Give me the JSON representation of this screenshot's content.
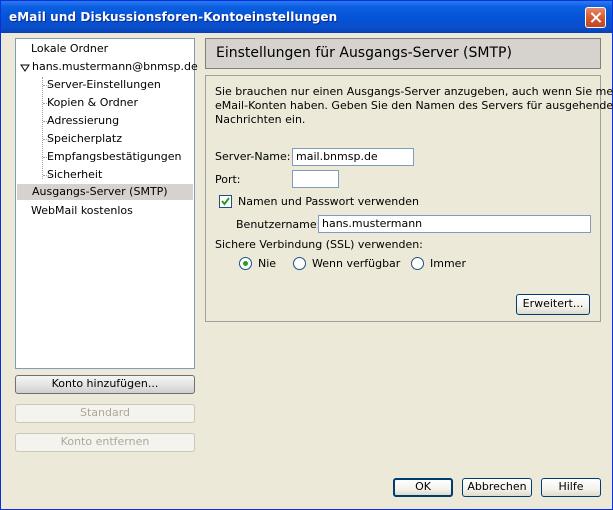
{
  "window": {
    "title": "eMail und Diskussionsforen-Kontoeinstellungen"
  },
  "tree": {
    "items": [
      {
        "label": "Lokale Ordner"
      },
      {
        "label": "hans.mustermann@bnmsp.de"
      },
      {
        "label": "Server-Einstellungen"
      },
      {
        "label": "Kopien & Ordner"
      },
      {
        "label": "Adressierung"
      },
      {
        "label": "Speicherplatz"
      },
      {
        "label": "Empfangsbestätigungen"
      },
      {
        "label": "Sicherheit"
      },
      {
        "label": "Ausgangs-Server (SMTP)"
      },
      {
        "label": "WebMail kostenlos"
      }
    ],
    "selected": "Ausgangs-Server (SMTP)"
  },
  "left_buttons": {
    "add_account": "Konto hinzufügen...",
    "default": "Standard",
    "remove_account": "Konto entfernen"
  },
  "panel": {
    "header": "Einstellungen für Ausgangs-Server (SMTP)",
    "description_line1": "Sie brauchen nur einen Ausgangs-Server anzugeben, auch wenn Sie mehrere",
    "description_line2": "eMail-Konten haben. Geben Sie den Namen des Servers für ausgehende",
    "description_line3": "Nachrichten ein.",
    "server_name_label": "Server-Name:",
    "server_name_value": "mail.bnmsp.de",
    "port_label": "Port:",
    "port_value": "",
    "use_auth_label": "Namen und Passwort verwenden",
    "use_auth_checked": true,
    "username_label": "Benutzername:",
    "username_value": "hans.mustermann",
    "ssl_label": "Sichere Verbindung (SSL) verwenden:",
    "ssl_options": [
      {
        "label": "Nie",
        "selected": true
      },
      {
        "label": "Wenn verfügbar",
        "selected": false
      },
      {
        "label": "Immer",
        "selected": false
      }
    ],
    "advanced_button": "Erweitert..."
  },
  "dialog_buttons": {
    "ok": "OK",
    "cancel": "Abbrechen",
    "help": "Hilfe"
  },
  "colors": {
    "titlebar": "#0552d6",
    "window_bg": "#ece9d8",
    "selected_row": "#d6d3ce",
    "radio_dot": "#21a121"
  }
}
